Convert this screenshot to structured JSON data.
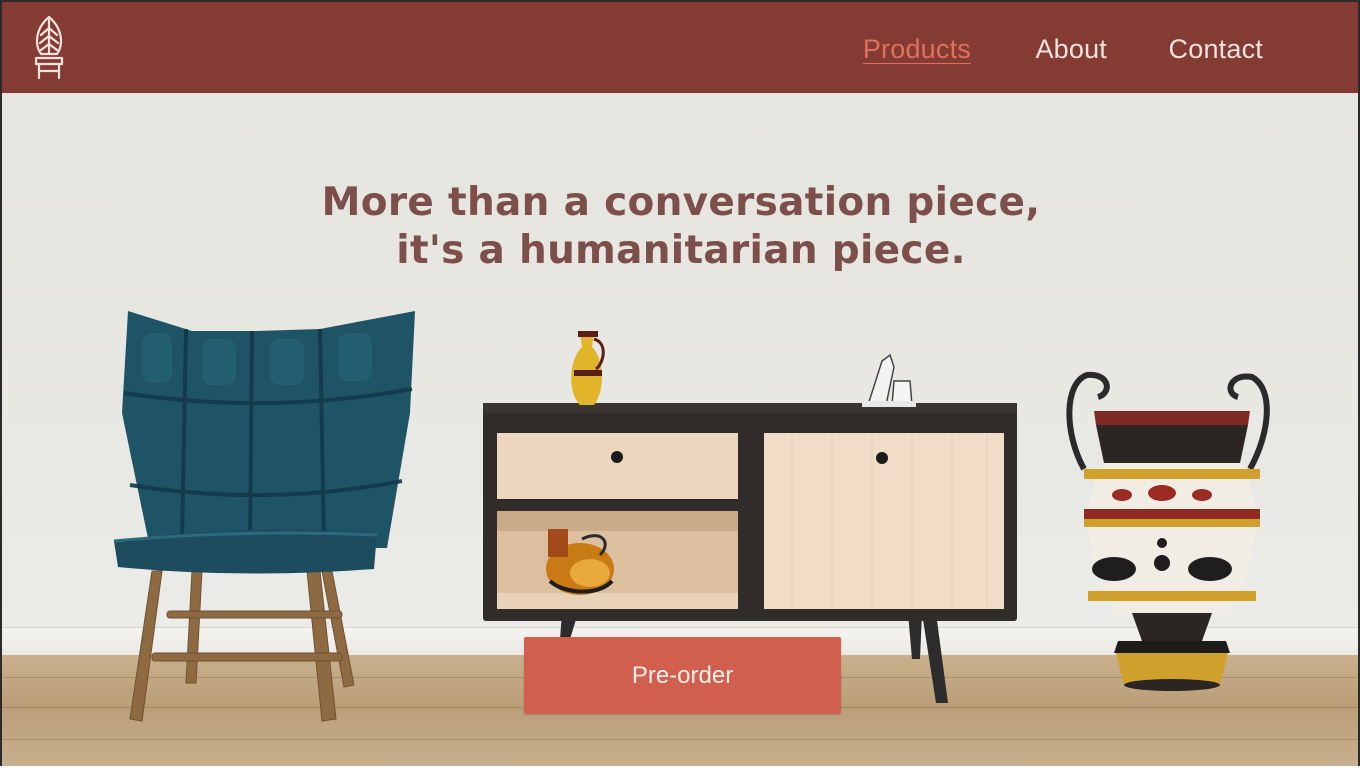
{
  "nav": {
    "logo_icon": "leaf-chair-logo-icon",
    "links": [
      {
        "label": "Products",
        "active": true
      },
      {
        "label": "About",
        "active": false
      },
      {
        "label": "Contact",
        "active": false
      }
    ]
  },
  "hero": {
    "headline_line1": "More than a conversation piece,",
    "headline_line2": "it's a humanitarian piece.",
    "cta_label": "Pre-order"
  },
  "colors": {
    "nav_background": "#843b33",
    "nav_text": "#f4e3dc",
    "nav_active": "#e0705c",
    "headline": "#7c4f4b",
    "cta_background": "#d15f4e",
    "wall": "#e7e6e1"
  }
}
